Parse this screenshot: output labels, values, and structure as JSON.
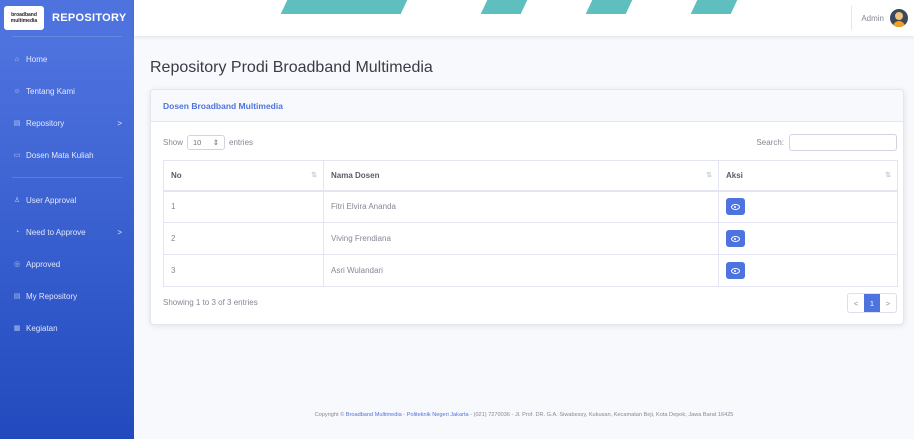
{
  "brand": {
    "logo_line1": "broadband",
    "logo_line2": "multimedia",
    "title": "REPOSITORY"
  },
  "sidebar": {
    "items": [
      {
        "label": "Home",
        "icon": "home-icon"
      },
      {
        "label": "Tentang Kami",
        "icon": "users-icon"
      },
      {
        "label": "Repository",
        "icon": "file-icon",
        "chevron": ">"
      },
      {
        "label": "Dosen Mata Kuliah",
        "icon": "chalkboard-icon"
      },
      {
        "label": "User Approval",
        "icon": "user-check-icon"
      },
      {
        "label": "Need to Approve",
        "icon": "clock-icon",
        "chevron": ">"
      },
      {
        "label": "Approved",
        "icon": "check-circle-icon"
      },
      {
        "label": "My Repository",
        "icon": "file-icon"
      },
      {
        "label": "Kegiatan",
        "icon": "calendar-icon"
      }
    ]
  },
  "topbar": {
    "user_name": "Admin"
  },
  "main": {
    "page_title": "Repository Prodi Broadband Multimedia",
    "card_title": "Dosen Broadband Multimedia",
    "show_label": "Show",
    "entries_value": "10",
    "entries_label": "entries",
    "search_label": "Search:",
    "table": {
      "headers": [
        "No",
        "Nama Dosen",
        "Aksi"
      ],
      "rows": [
        {
          "no": "1",
          "nama": "Fitri Elvira Ananda"
        },
        {
          "no": "2",
          "nama": "Viving Frendiana"
        },
        {
          "no": "3",
          "nama": "Asri Wulandari"
        }
      ]
    },
    "info": "Showing 1 to 3 of 3 entries",
    "pagination": {
      "prev": "<",
      "current": "1",
      "next": ">"
    }
  },
  "footer": {
    "prefix": "Copyright ©",
    "link1": "Broadband Multimedia",
    "sep": " - ",
    "link2": "Politeknik Negeri Jakarta",
    "rest": " - (021) 7270036 - Jl. Prof. DR. G.A. Siwabessy, Kukusan, Kecamatan Beji, Kota Depok, Jawa Barat 16425"
  },
  "colors": {
    "primary": "#4e73df",
    "sidebar_end": "#224abe",
    "accent_teal": "#5fbfbf"
  }
}
